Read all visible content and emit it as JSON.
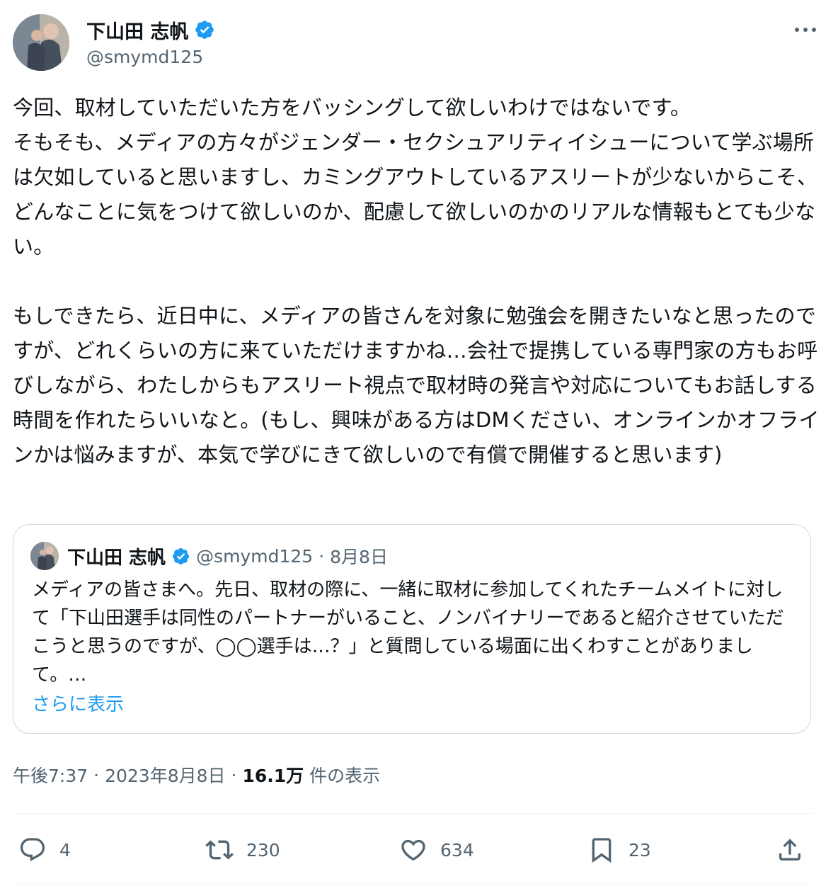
{
  "author": {
    "display_name": "下山田 志帆",
    "handle": "@smymd125",
    "verified_color": "#1d9bf0"
  },
  "tweet": {
    "text": "今回、取材していただいた方をバッシングして欲しいわけではないです。\nそもそも、メディアの方々がジェンダー・セクシュアリティイシューについて学ぶ場所は欠如していると思いますし、カミングアウトしているアスリートが少ないからこそ、どんなことに気をつけて欲しいのか、配慮して欲しいのかのリアルな情報もとても少ない。\n\nもしできたら、近日中に、メディアの皆さんを対象に勉強会を開きたいなと思ったのですが、どれくらいの方に来ていただけますかね…会社で提携している専門家の方もお呼びしながら、わたしからもアスリート視点で取材時の発言や対応についてもお話しする時間を作れたらいいなと。(もし、興味がある方はDMください、オンラインかオフラインかは悩みますが、本気で学びにきて欲しいので有償で開催すると思います)",
    "time": "午後7:37",
    "separator": "·",
    "date": "2023年8月8日",
    "views_count": "16.1万",
    "views_label": "件の表示"
  },
  "quoted": {
    "display_name": "下山田 志帆",
    "handle": "@smymd125",
    "separator": "·",
    "date": "8月8日",
    "text": "メディアの皆さまへ。先日、取材の際に、一緒に取材に参加してくれたチームメイトに対して「下山田選手は同性のパートナーがいること、ノンバイナリーであると紹介させていただこうと思うのですが、◯◯選手は…？」と質問している場面に出くわすことがありまして。…",
    "show_more": "さらに表示"
  },
  "actions": {
    "replies": "4",
    "reposts": "230",
    "likes": "634",
    "bookmarks": "23"
  },
  "icons": [
    "more-icon",
    "verified-icon",
    "reply-icon",
    "repost-icon",
    "like-icon",
    "bookmark-icon",
    "share-icon"
  ]
}
